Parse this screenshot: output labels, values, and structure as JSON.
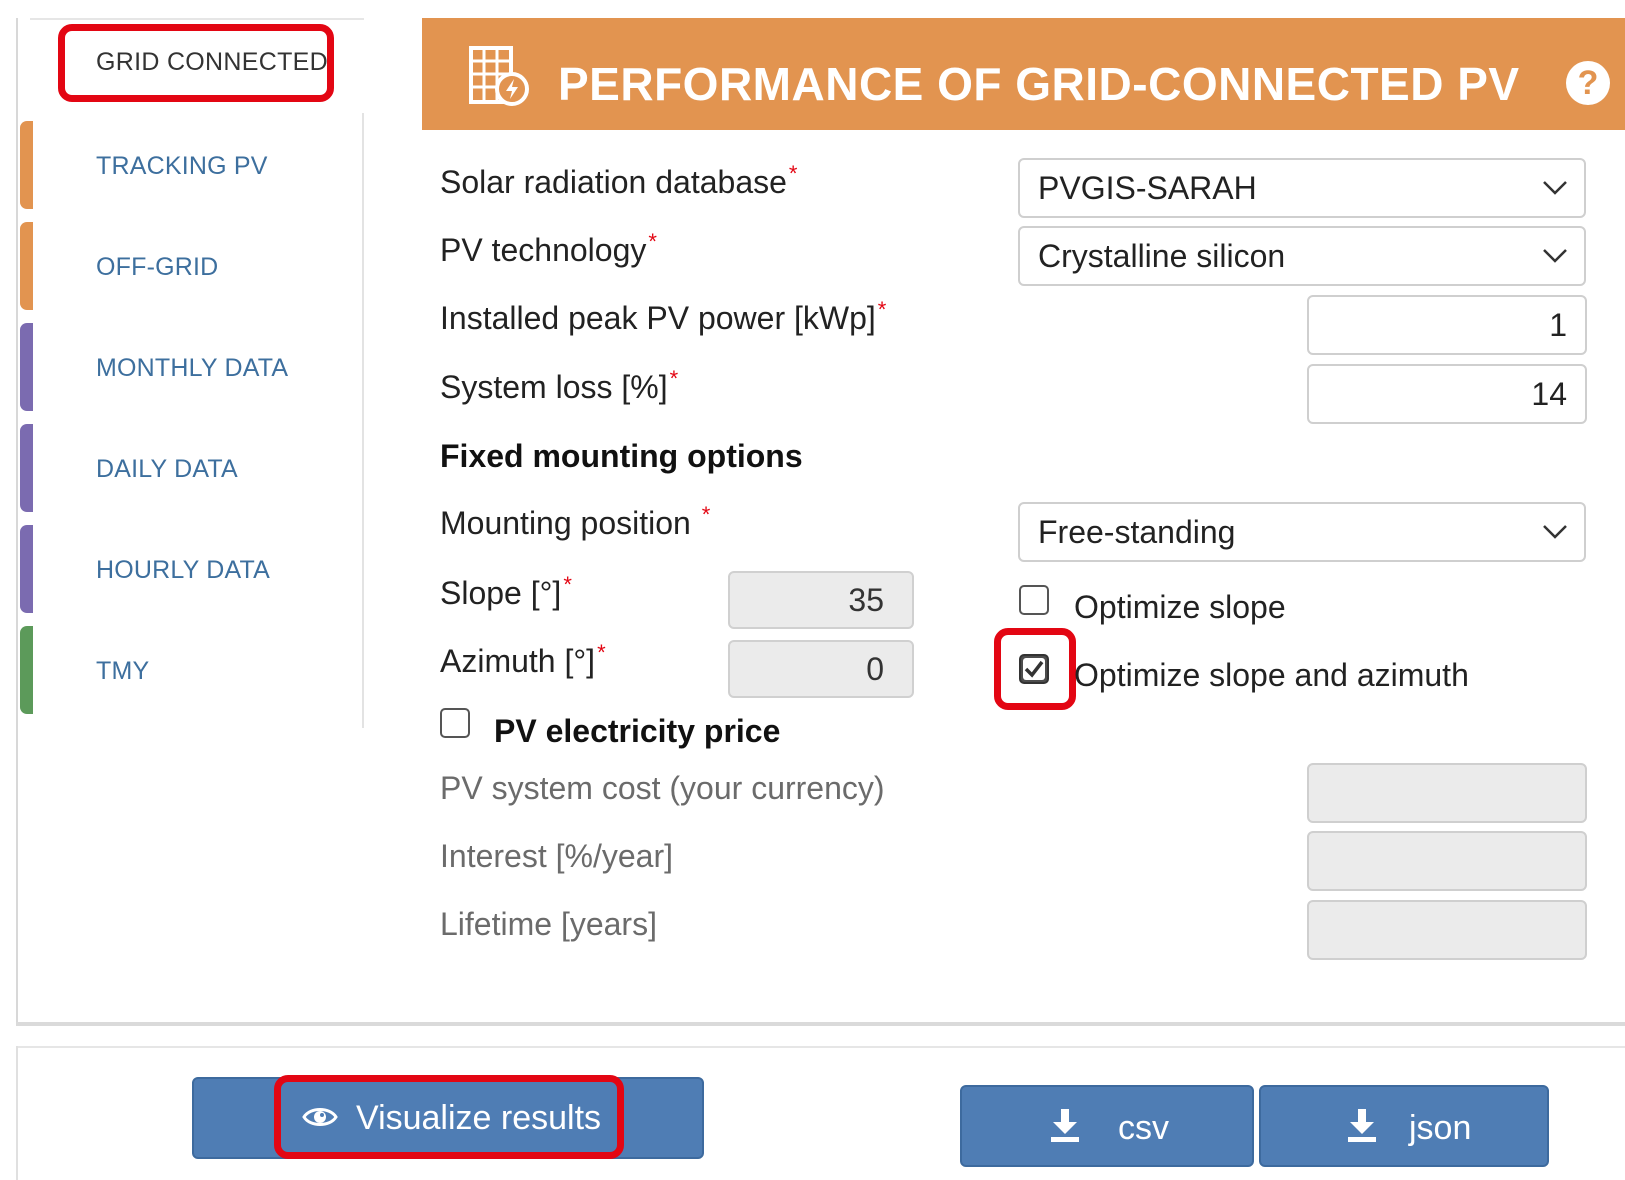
{
  "nav": {
    "active_tab": "GRID CONNECTED",
    "items": [
      {
        "label": "TRACKING PV",
        "color": "#e29450"
      },
      {
        "label": "OFF-GRID",
        "color": "#e29450"
      },
      {
        "label": "MONTHLY DATA",
        "color": "#7b6bb0"
      },
      {
        "label": "DAILY DATA",
        "color": "#7b6bb0"
      },
      {
        "label": "HOURLY DATA",
        "color": "#7b6bb0"
      },
      {
        "label": "TMY",
        "color": "#5c9a5a"
      }
    ]
  },
  "header": {
    "title": "PERFORMANCE OF GRID-CONNECTED PV",
    "help": "?",
    "color": "#e29450",
    "icon": "solar-panel-icon"
  },
  "form": {
    "database": {
      "label": "Solar radiation database",
      "required": "*",
      "value": "PVGIS-SARAH"
    },
    "technology": {
      "label": "PV technology",
      "required": "*",
      "value": "Crystalline silicon"
    },
    "peak_power": {
      "label": "Installed peak PV power [kWp]",
      "required": "*",
      "value": "1"
    },
    "system_loss": {
      "label": "System loss [%]",
      "required": "*",
      "value": "14"
    },
    "mounting_heading": "Fixed mounting options",
    "mounting_position": {
      "label": "Mounting position",
      "required": "*",
      "value": "Free-standing"
    },
    "slope": {
      "label": "Slope [°]",
      "required": "*",
      "value": "35"
    },
    "azimuth": {
      "label": "Azimuth [°]",
      "required": "*",
      "value": "0"
    },
    "optimize_slope": {
      "label": "Optimize slope",
      "checked": false
    },
    "optimize_slope_azimuth": {
      "label": "Optimize slope and azimuth",
      "checked": true
    },
    "price": {
      "label": "PV electricity price",
      "checked": false
    },
    "system_cost": {
      "label": "PV system cost (your currency)",
      "value": ""
    },
    "interest": {
      "label": "Interest [%/year]",
      "value": ""
    },
    "lifetime": {
      "label": "Lifetime [years]",
      "value": ""
    }
  },
  "footer": {
    "visualize": "Visualize results",
    "csv": "csv",
    "json": "json"
  },
  "colors": {
    "highlight": "#e30613",
    "button": "#4f7db4",
    "nav_text": "#3d6f9e"
  }
}
